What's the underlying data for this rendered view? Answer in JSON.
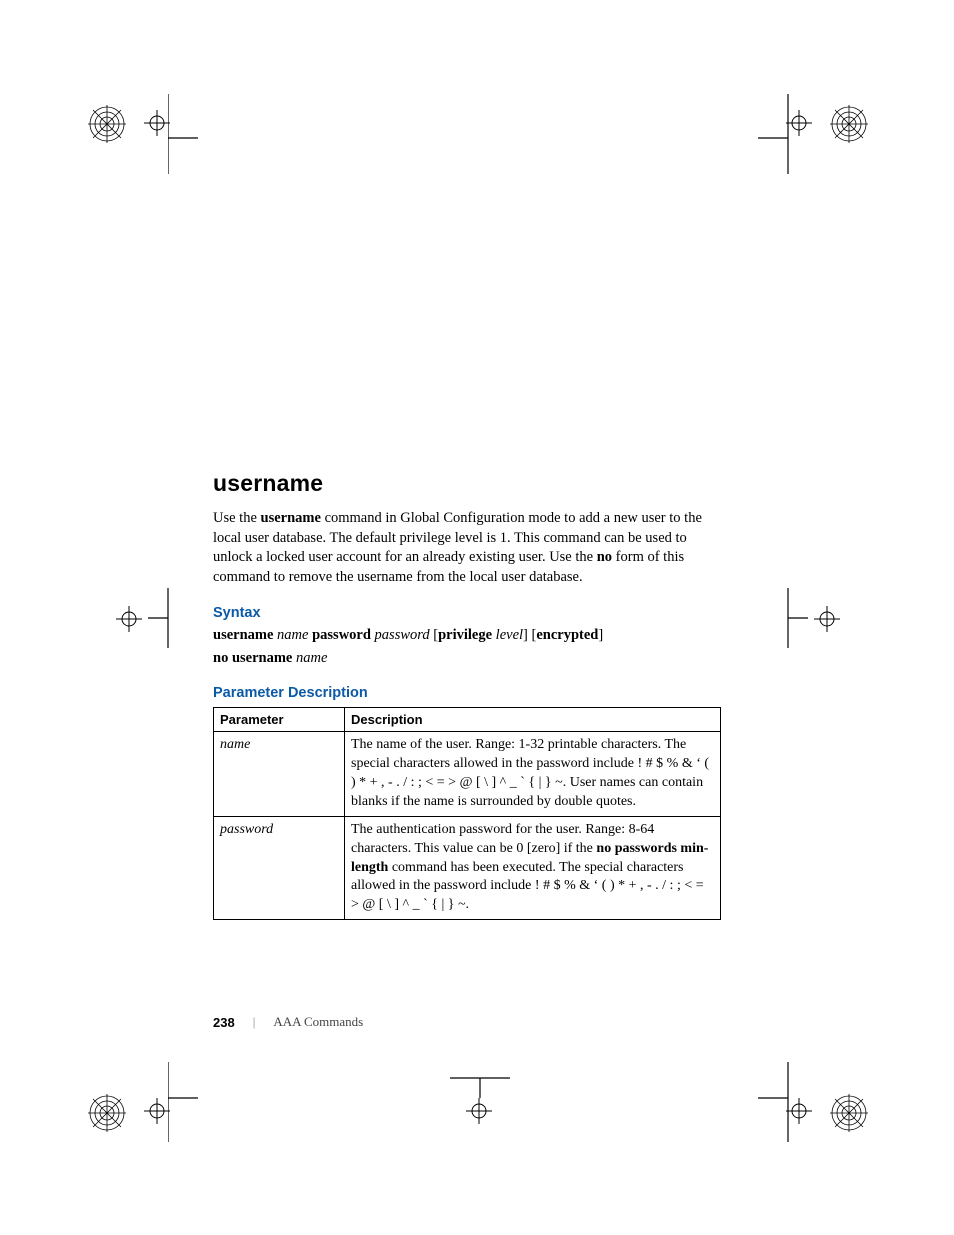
{
  "title": "username",
  "intro_segments": [
    {
      "t": "Use the "
    },
    {
      "t": "username",
      "b": true
    },
    {
      "t": " command in Global Configuration mode to add a new user to the local user database. The default privilege level is 1. This command can be used to unlock a locked user account for an already existing user. Use the "
    },
    {
      "t": "no",
      "b": true
    },
    {
      "t": " form of this command to remove the username from the local user database."
    }
  ],
  "sections": {
    "syntax": "Syntax",
    "param_desc": "Parameter Description"
  },
  "syntax_line1": [
    {
      "t": "username ",
      "b": true
    },
    {
      "t": "name",
      "i": true
    },
    {
      "t": " password ",
      "b": true
    },
    {
      "t": "password",
      "i": true
    },
    {
      "t": " ["
    },
    {
      "t": "privilege ",
      "b": true
    },
    {
      "t": "level",
      "i": true
    },
    {
      "t": "] ["
    },
    {
      "t": "encrypted",
      "b": true
    },
    {
      "t": "]"
    }
  ],
  "syntax_line2": [
    {
      "t": "no username ",
      "b": true
    },
    {
      "t": "name",
      "i": true
    }
  ],
  "table": {
    "headers": [
      "Parameter",
      "Description"
    ],
    "rows": [
      {
        "param": "name",
        "desc_segments": [
          {
            "t": "The name of the user. Range: 1-32 printable characters. The special characters allowed in the password include !  #  $  %  & ‘  (  )  *  +  ,  -  .  /  :  ;  <  =  >  @  [  \\  ]  ^  _  `  {  |  }  ~. User names can contain blanks if the name is surrounded by double quotes."
          }
        ]
      },
      {
        "param": "password",
        "desc_segments": [
          {
            "t": "The authentication password for the user. Range: 8-64 characters. This value can be 0 [zero] if the "
          },
          {
            "t": "no passwords min-length",
            "b": true
          },
          {
            "t": " command has been executed. The special characters allowed in the password include !  #  $  %  &  ‘  (  )  *  +  ,  -  .  /  :  ;  <  =  > @  [  \\  ]  ^  _  `  {  |  }  ~."
          }
        ]
      }
    ]
  },
  "footer": {
    "page_number": "238",
    "separator": "|",
    "chapter": "AAA Commands"
  }
}
